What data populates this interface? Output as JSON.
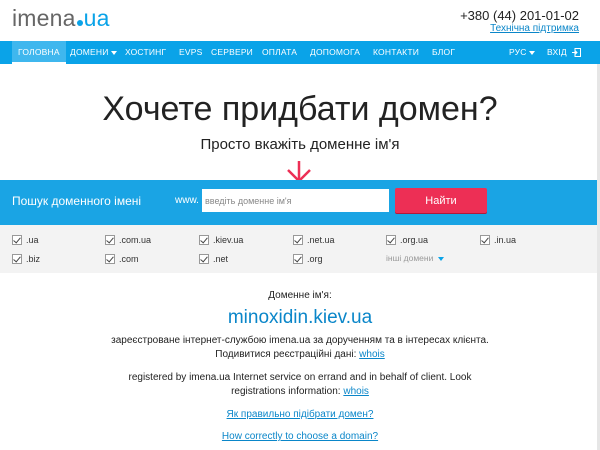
{
  "header": {
    "logo_main": "imena",
    "logo_suffix": "ua",
    "phone": "+380 (44) 201-01-02",
    "support": "Технічна підтримка"
  },
  "nav": {
    "items": [
      {
        "label": "ГОЛОВНА"
      },
      {
        "label": "ДОМЕНИ"
      },
      {
        "label": "ХОСТИНГ"
      },
      {
        "label": "eVPS"
      },
      {
        "label": "СЕРВЕРИ"
      },
      {
        "label": "ОПЛАТА"
      },
      {
        "label": "ДОПОМОГА"
      },
      {
        "label": "КОНТАКТИ"
      },
      {
        "label": "БЛОГ"
      }
    ],
    "lang": "РУС",
    "login": "ВХІД"
  },
  "hero": {
    "title": "Хочете придбати домен?",
    "subtitle": "Просто вкажіть доменне ім'я"
  },
  "search": {
    "label": "Пошук доменного імені",
    "prefix": "www.",
    "placeholder": "введіть доменне ім'я",
    "button": "Найти"
  },
  "zones": {
    "row1": [
      ".ua",
      ".com.ua",
      ".kiev.ua",
      ".net.ua",
      ".org.ua",
      ".in.ua"
    ],
    "row2": [
      ".biz",
      ".com",
      ".net",
      ".org"
    ],
    "more": "інші домени"
  },
  "result": {
    "label": "Доменне ім'я:",
    "domain": "minoxidin.kiev.ua",
    "ua_line1": "зареєстроване інтернет-службою imena.ua за дорученням та в інтересах клієнта.",
    "ua_line2": "Подивитися реєстраційні дані:",
    "whois": "whois",
    "en_line1": "registered by imena.ua Internet service on errand and in behalf of client. Look",
    "en_line2": "registrations information:",
    "link_ua": "Як правильно підібрати домен?",
    "link_en": "How correctly to choose a domain?"
  },
  "colors": {
    "brand": "#0aa3e8",
    "button": "#ed2f55",
    "arrow": "#ed2f55"
  }
}
